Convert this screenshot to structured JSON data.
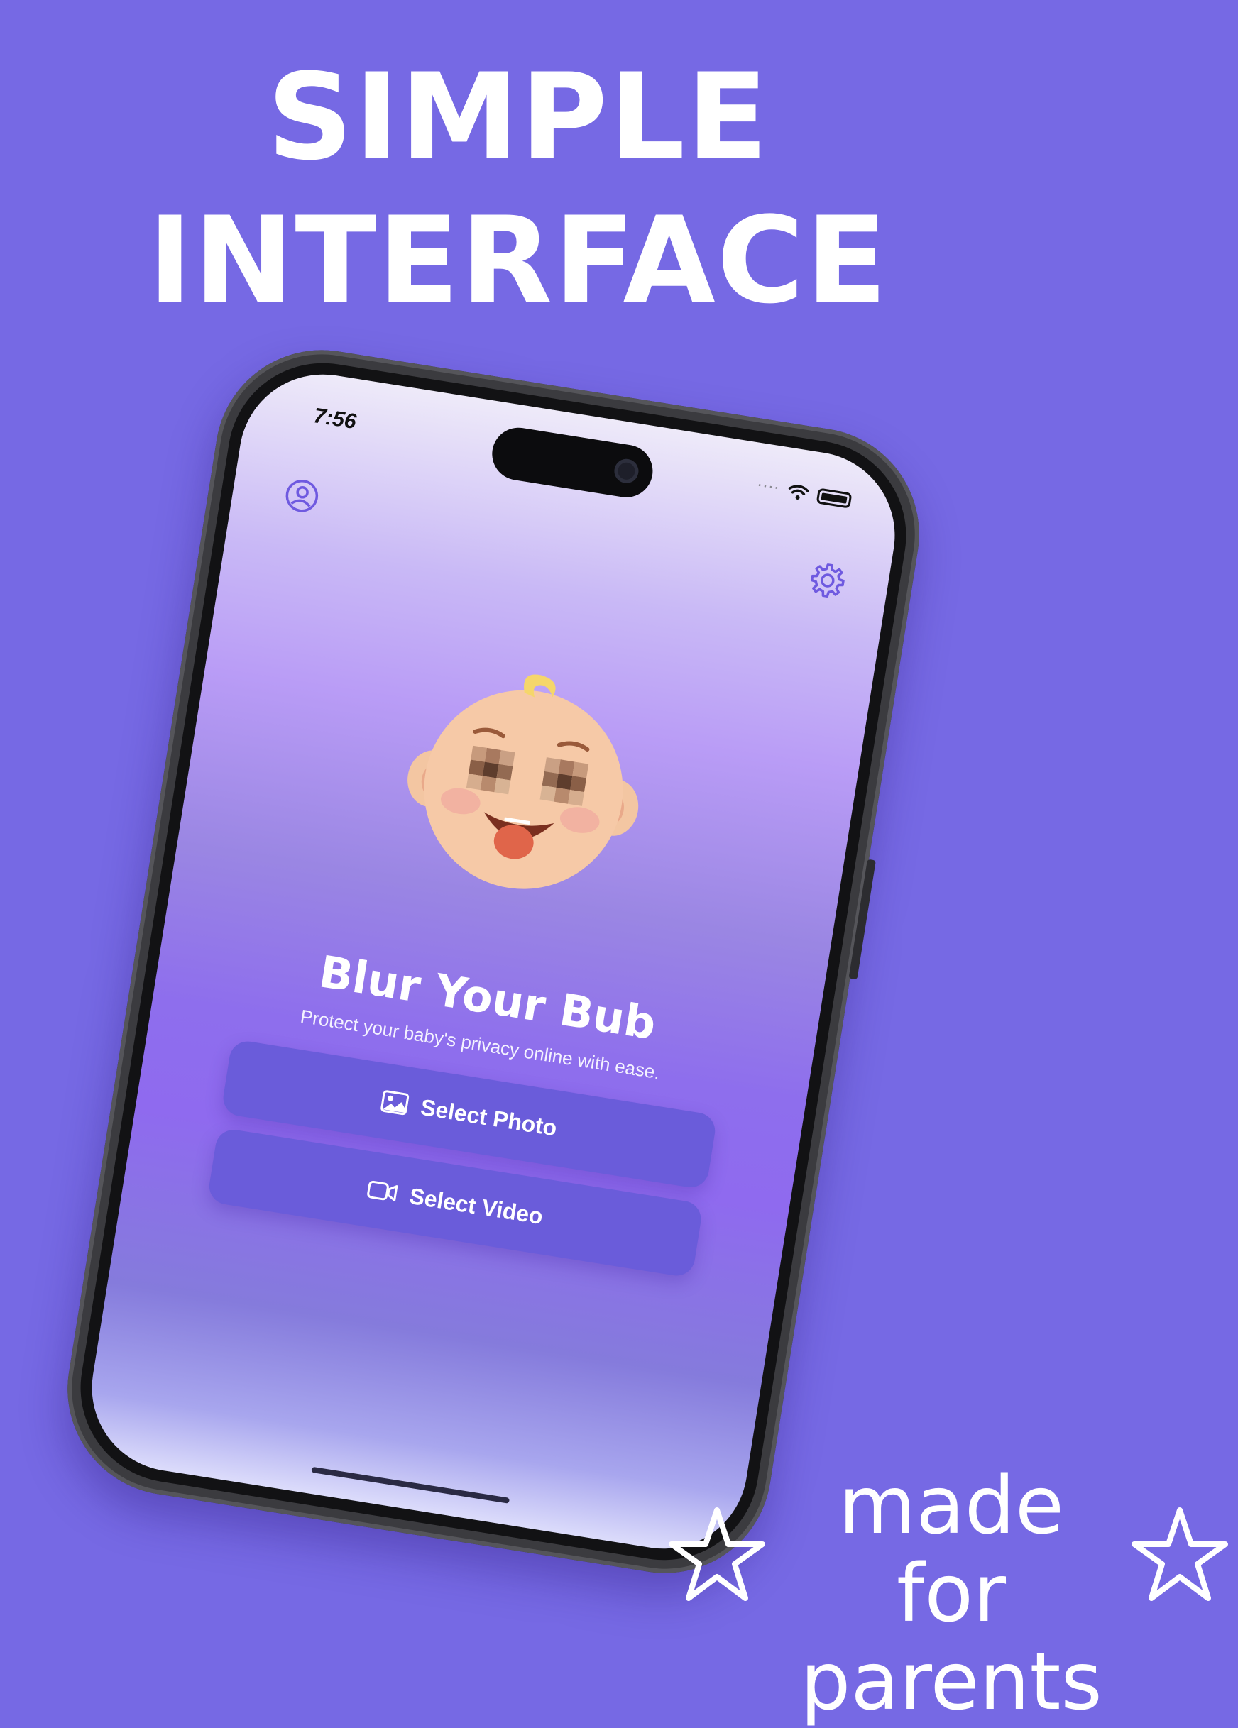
{
  "promo": {
    "headline_line1": "SIMPLE",
    "headline_line2": "INTERFACE",
    "footer_line1": "made for",
    "footer_line2": "parents"
  },
  "status_bar": {
    "time": "7:56"
  },
  "app": {
    "title": "Blur Your Bub",
    "tagline": "Protect your baby's privacy online with ease.",
    "select_photo_label": "Select Photo",
    "select_video_label": "Select Video"
  },
  "icons": {
    "profile": "person-circle-icon",
    "settings": "gear-icon",
    "photo": "photo-icon",
    "video": "video-camera-icon",
    "wifi": "wifi-icon",
    "battery": "battery-icon",
    "star": "star-doodle-icon"
  },
  "colors": {
    "background": "#7669e4",
    "button": "#6a5cda",
    "accent": "#6f5ae0",
    "text_light": "#ffffff"
  }
}
